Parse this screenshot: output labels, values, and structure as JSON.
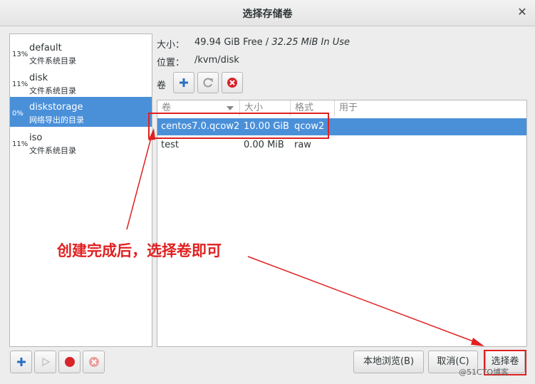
{
  "window": {
    "title": "选择存储卷"
  },
  "pools": [
    {
      "pct": "13%",
      "name": "default",
      "type": "文件系统目录"
    },
    {
      "pct": "11%",
      "name": "disk",
      "type": "文件系统目录"
    },
    {
      "pct": "0%",
      "name": "diskstorage",
      "type": "网络导出的目录"
    },
    {
      "pct": "11%",
      "name": "iso",
      "type": "文件系统目录"
    }
  ],
  "info": {
    "size_label": "大小：",
    "free": "49.94 GiB Free / ",
    "in_use": "32.25 MiB In Use",
    "location_label": "位置：",
    "location": "/kvm/disk",
    "volumes_label": "卷"
  },
  "table": {
    "headers": [
      "卷",
      "大小",
      "格式",
      "用于"
    ],
    "rows": [
      {
        "name": "centos7.0.qcow2",
        "size": "10.00 GiB",
        "format": "qcow2",
        "used": ""
      },
      {
        "name": "test",
        "size": "0.00 MiB",
        "format": "raw",
        "used": ""
      }
    ]
  },
  "annotation": "创建完成后，选择卷即可",
  "buttons": {
    "browse": "本地浏览(B)",
    "cancel": "取消(C)",
    "choose": "选择卷"
  },
  "watermark": "@51CTO博客",
  "colors": {
    "selection": "#4a90d9",
    "annotation": "#e02020"
  }
}
